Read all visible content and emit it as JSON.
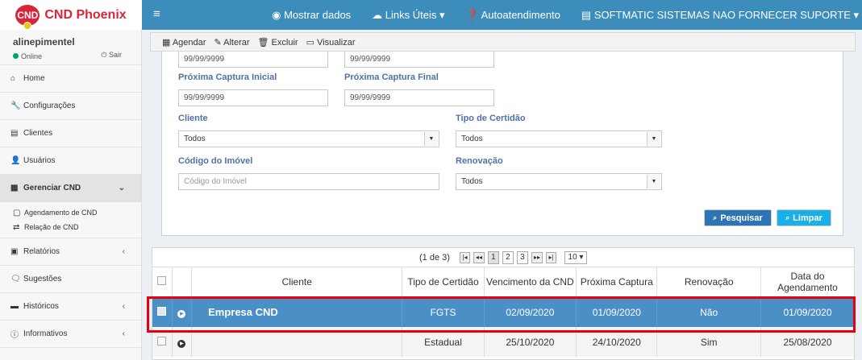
{
  "app": {
    "brand_badge": "CND",
    "brand_name": "CND Phoenix"
  },
  "topnav": {
    "menu_icon": "bars-icon",
    "items": [
      {
        "icon": "eye-icon",
        "label": "Mostrar dados"
      },
      {
        "icon": "cloud-icon",
        "label": "Links Úteis ▾"
      },
      {
        "icon": "question-circle-icon",
        "label": "Autoatendimento"
      },
      {
        "icon": "building-icon",
        "label": "SOFTMATIC SISTEMAS NAO FORNECER SUPORTE ▾"
      }
    ]
  },
  "user": {
    "name": "alinepimentel",
    "status": "Online",
    "logout": "Sair"
  },
  "sidebar": {
    "items": [
      {
        "icon": "home-icon",
        "label": "Home"
      },
      {
        "icon": "wrench-icon",
        "label": "Configurações"
      },
      {
        "icon": "building-icon",
        "label": "Clientes"
      },
      {
        "icon": "user-icon",
        "label": "Usuários"
      },
      {
        "icon": "calendar-icon",
        "label": "Gerenciar CND",
        "arrow": "⌄"
      },
      {
        "icon": "file-icon",
        "label": "Relatórios",
        "arrow": "‹"
      },
      {
        "icon": "comments-icon",
        "label": "Sugestões"
      },
      {
        "icon": "archive-icon",
        "label": "Históricos",
        "arrow": "‹"
      },
      {
        "icon": "info-icon",
        "label": "Informativos",
        "arrow": "‹"
      }
    ],
    "submenu": [
      {
        "icon": "calendar-icon",
        "label": "Agendamento de CND"
      },
      {
        "icon": "retweet-icon",
        "label": "Relação de CND"
      }
    ]
  },
  "toolbar": {
    "agendar": "Agendar",
    "alterar": "Alterar",
    "excluir": "Excluir",
    "visualizar": "Visualizar"
  },
  "form": {
    "date_a": "99/99/9999",
    "date_b": "99/99/9999",
    "proxima_inicial_label": "Próxima Captura Inicial",
    "proxima_final_label": "Próxima Captura Final",
    "proxima_inicial_value": "99/99/9999",
    "proxima_final_value": "99/99/9999",
    "cliente_label": "Cliente",
    "cliente_value": "Todos",
    "tipo_label": "Tipo de Certidão",
    "tipo_value": "Todos",
    "codigo_label": "Código do Imóvel",
    "codigo_placeholder": "Código do Imóvel",
    "renovacao_label": "Renovação",
    "renovacao_value": "Todos",
    "pesquisar": "Pesquisar",
    "limpar": "Limpar"
  },
  "pager": {
    "summary": "(1 de 3)",
    "first": "|◂",
    "prev": "◂◂",
    "pages": [
      "1",
      "2",
      "3"
    ],
    "next": "▸▸",
    "last": "▸|",
    "rows_per_page": "10 ▾"
  },
  "table": {
    "headers": [
      "Cliente",
      "Tipo de Certidão",
      "Vencimento da CND",
      "Próxima Captura",
      "Renovação",
      "Data do Agendamento"
    ],
    "rows": [
      {
        "cliente": "Empresa CND",
        "tipo": "FGTS",
        "vencimento": "02/09/2020",
        "proxima": "01/09/2020",
        "renovacao": "Não",
        "agendamento": "01/09/2020"
      },
      {
        "cliente": "",
        "tipo": "Estadual",
        "vencimento": "25/10/2020",
        "proxima": "24/10/2020",
        "renovacao": "Sim",
        "agendamento": "25/08/2020"
      }
    ]
  },
  "colors": {
    "topbar": "#3c8dbc",
    "brand": "#d9243a",
    "selected_row": "#4a90c6",
    "highlight": "#e8000e",
    "btn_pesquisar": "#2e74b5",
    "btn_limpar": "#1ab0e5"
  }
}
